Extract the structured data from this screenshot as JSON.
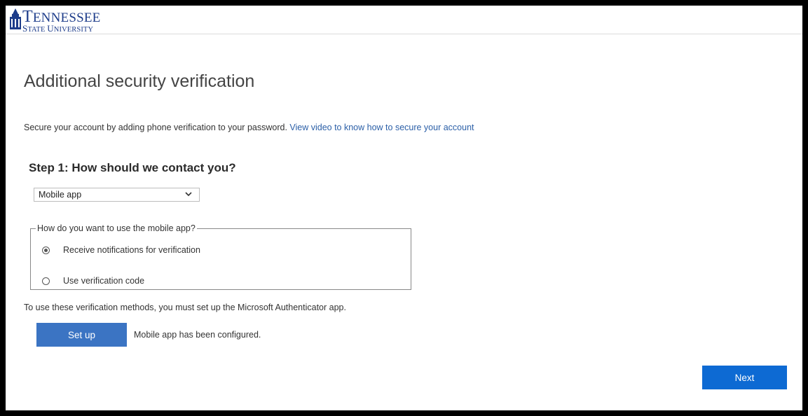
{
  "brand": {
    "name_line1_cap": "T",
    "name_line1_rest": "ENNESSEE",
    "name_line2_cap1": "S",
    "name_line2_rest1": "TATE ",
    "name_line2_cap2": "U",
    "name_line2_rest2": "NIVERSITY",
    "color": "#1d3c8a"
  },
  "page": {
    "title": "Additional security verification",
    "intro_text": "Secure your account by adding phone verification to your password. ",
    "intro_link": "View video to know how to secure your account"
  },
  "step1": {
    "title": "Step 1: How should we contact you?",
    "contact_method": {
      "selected": "Mobile app"
    },
    "mobile_app_group": {
      "legend": "How do you want to use the mobile app?",
      "options": [
        {
          "label": "Receive notifications for verification",
          "checked": true
        },
        {
          "label": "Use verification code",
          "checked": false
        }
      ]
    },
    "note": "To use these verification methods, you must set up the Microsoft Authenticator app.",
    "setup_button": "Set up",
    "status": "Mobile app has been configured."
  },
  "footer": {
    "next_button": "Next"
  },
  "colors": {
    "setup_button": "#3b74c3",
    "next_button": "#0d6ad3",
    "link": "#2b5fa7"
  }
}
